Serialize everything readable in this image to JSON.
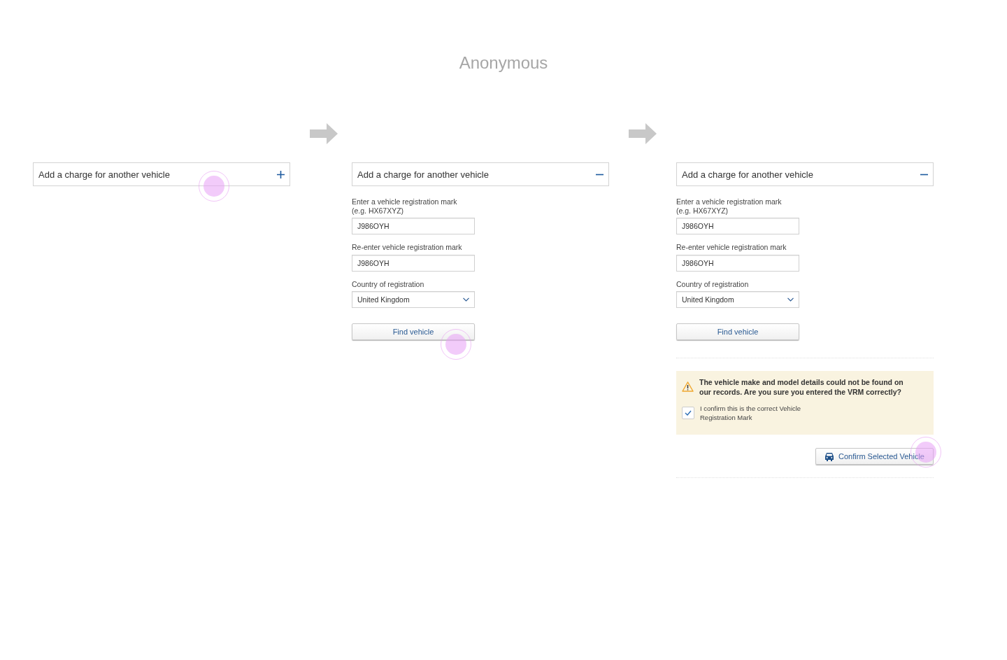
{
  "title": "Anonymous",
  "steps": [
    {
      "header": {
        "title": "Add a charge for another vehicle",
        "expanded": false,
        "tapped": true
      }
    },
    {
      "header": {
        "title": "Add a charge for another vehicle",
        "expanded": true,
        "tapped": false
      },
      "form": {
        "fields": [
          {
            "kind": "text",
            "label": "Enter a vehicle registration mark",
            "hint": "(e.g. HX67XYZ)",
            "value": "J986OYH"
          },
          {
            "kind": "text",
            "label": "Re-enter vehicle registration mark",
            "value": "J986OYH"
          },
          {
            "kind": "select",
            "label": "Country of registration",
            "value": "United Kingdom"
          }
        ],
        "find_button": {
          "label": "Find vehicle",
          "tapped": true
        }
      }
    },
    {
      "header": {
        "title": "Add a charge for another vehicle",
        "expanded": true,
        "tapped": false
      },
      "form": {
        "fields": [
          {
            "kind": "text",
            "label": "Enter a vehicle registration mark",
            "hint": "(e.g. HX67XYZ)",
            "value": "J986OYH"
          },
          {
            "kind": "text",
            "label": "Re-enter vehicle registration mark",
            "value": "J986OYH"
          },
          {
            "kind": "select",
            "label": "Country of registration",
            "value": "United Kingdom"
          }
        ],
        "find_button": {
          "label": "Find vehicle",
          "tapped": false
        }
      },
      "warning": {
        "message": "The vehicle make and model details could not be found on our records. Are you sure you entered the VRM correctly?",
        "checkbox": {
          "label": "I confirm this is the correct Vehicle Registration Mark",
          "checked": true
        }
      },
      "confirm_button": {
        "label": "Confirm Selected Vehicle",
        "tapped": true
      }
    }
  ]
}
